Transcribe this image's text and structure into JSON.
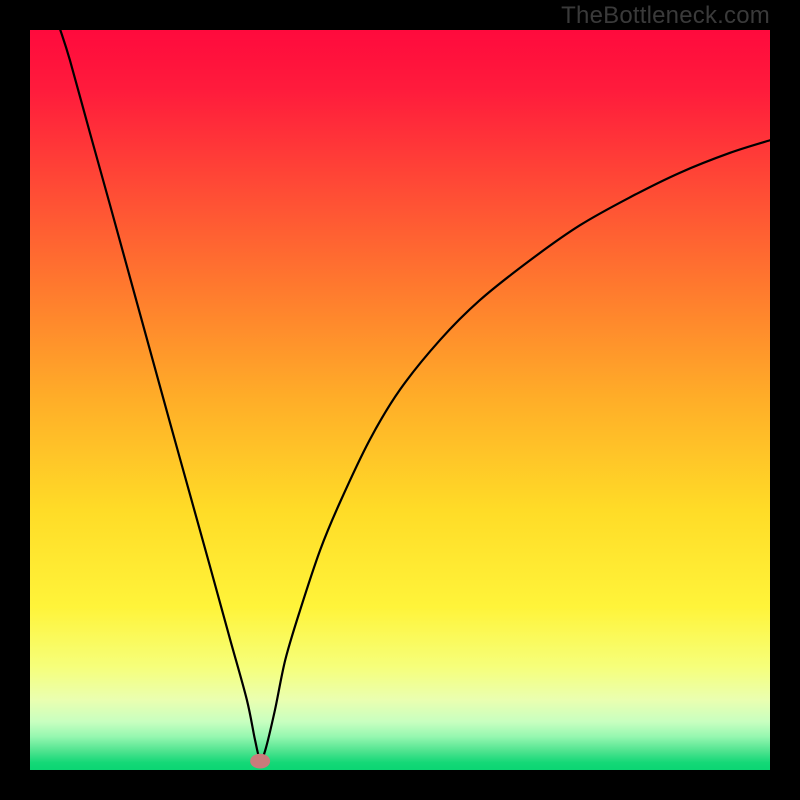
{
  "watermark": "TheBottleneck.com",
  "colors": {
    "frame": "#000000",
    "curve": "#000000",
    "marker_fill": "#c97b7b",
    "gradient_stops": [
      {
        "offset": 0.0,
        "color": "#ff0a3d"
      },
      {
        "offset": 0.08,
        "color": "#ff1b3c"
      },
      {
        "offset": 0.2,
        "color": "#ff4636"
      },
      {
        "offset": 0.35,
        "color": "#ff7a2e"
      },
      {
        "offset": 0.5,
        "color": "#ffae28"
      },
      {
        "offset": 0.65,
        "color": "#ffdc27"
      },
      {
        "offset": 0.78,
        "color": "#fff43a"
      },
      {
        "offset": 0.86,
        "color": "#f6ff7a"
      },
      {
        "offset": 0.905,
        "color": "#eaffb0"
      },
      {
        "offset": 0.935,
        "color": "#c8ffc0"
      },
      {
        "offset": 0.955,
        "color": "#95f7b0"
      },
      {
        "offset": 0.975,
        "color": "#4de38e"
      },
      {
        "offset": 0.99,
        "color": "#14d877"
      },
      {
        "offset": 1.0,
        "color": "#0bd573"
      }
    ]
  },
  "chart_data": {
    "type": "line",
    "title": "",
    "xlabel": "",
    "ylabel": "",
    "xlim": [
      0,
      100
    ],
    "ylim": [
      0,
      100
    ],
    "grid": false,
    "legend": false,
    "note": "V-shaped bottleneck curve. Minimum (optimal/no-bottleneck) near x≈31. Values estimated from pixels of a 740×740 plot area.",
    "series": [
      {
        "name": "curve",
        "x": [
          4.1,
          5.4,
          8.1,
          10.8,
          13.5,
          16.2,
          18.9,
          21.6,
          24.3,
          27.0,
          29.3,
          30.4,
          31.1,
          31.8,
          33.1,
          34.5,
          36.5,
          39.2,
          41.9,
          45.9,
          50.0,
          55.4,
          60.8,
          67.6,
          74.3,
          81.1,
          87.8,
          94.6,
          100.0
        ],
        "y": [
          100.0,
          95.9,
          86.1,
          76.4,
          66.6,
          56.8,
          47.0,
          37.3,
          27.6,
          17.8,
          9.5,
          4.1,
          1.4,
          2.7,
          8.1,
          14.9,
          21.6,
          29.7,
          36.2,
          44.6,
          51.4,
          58.1,
          63.5,
          68.9,
          73.6,
          77.4,
          80.7,
          83.4,
          85.1
        ]
      }
    ],
    "marker": {
      "x": 31.1,
      "y": 1.2,
      "rx": 1.35,
      "ry": 1.0
    }
  }
}
